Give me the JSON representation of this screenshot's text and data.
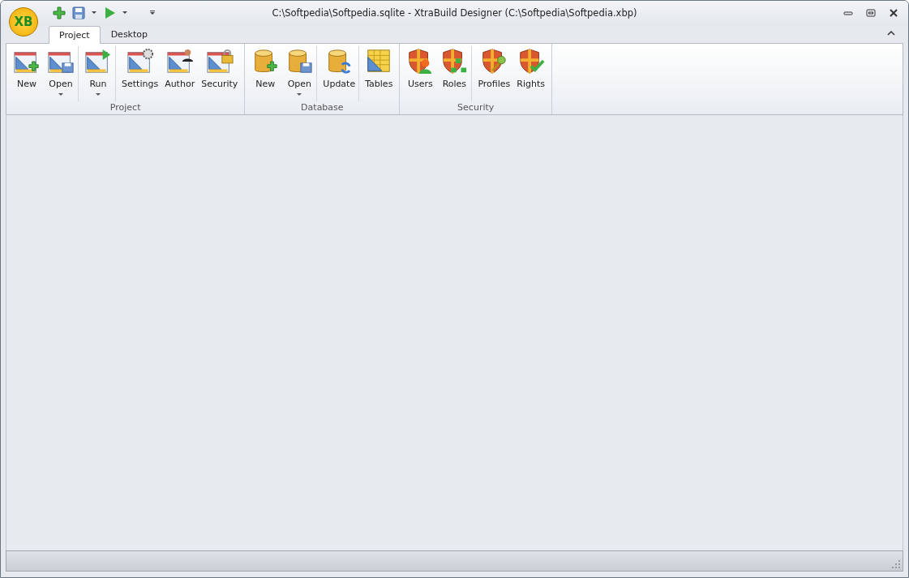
{
  "window": {
    "title": "C:\\Softpedia\\Softpedia.sqlite - XtraBuild Designer (C:\\Softpedia\\Softpedia.xbp)",
    "logo_text": "XB"
  },
  "tabs": [
    {
      "label": "Project",
      "selected": true
    },
    {
      "label": "Desktop",
      "selected": false
    }
  ],
  "groups": [
    {
      "label": "Project",
      "buttons": [
        {
          "label": "New",
          "kind": "project-new",
          "dropdown": false,
          "divider_after": false
        },
        {
          "label": "Open",
          "kind": "project-open",
          "dropdown": true,
          "divider_after": true
        },
        {
          "label": "Run",
          "kind": "project-run",
          "dropdown": true,
          "divider_after": true
        },
        {
          "label": "Settings",
          "kind": "project-settings",
          "dropdown": false,
          "divider_after": false
        },
        {
          "label": "Author",
          "kind": "project-author",
          "dropdown": false,
          "divider_after": false
        },
        {
          "label": "Security",
          "kind": "project-security",
          "dropdown": false,
          "divider_after": false
        }
      ]
    },
    {
      "label": "Database",
      "buttons": [
        {
          "label": "New",
          "kind": "db-new",
          "dropdown": false,
          "divider_after": false
        },
        {
          "label": "Open",
          "kind": "db-open",
          "dropdown": true,
          "divider_after": true
        },
        {
          "label": "Update",
          "kind": "db-update",
          "dropdown": false,
          "divider_after": true
        },
        {
          "label": "Tables",
          "kind": "db-tables",
          "dropdown": false,
          "divider_after": false
        }
      ]
    },
    {
      "label": "Security",
      "buttons": [
        {
          "label": "Users",
          "kind": "sec-users",
          "dropdown": false,
          "divider_after": false
        },
        {
          "label": "Roles",
          "kind": "sec-roles",
          "dropdown": false,
          "divider_after": true
        },
        {
          "label": "Profiles",
          "kind": "sec-profiles",
          "dropdown": false,
          "divider_after": false
        },
        {
          "label": "Rights",
          "kind": "sec-rights",
          "dropdown": false,
          "divider_after": false
        }
      ]
    }
  ]
}
